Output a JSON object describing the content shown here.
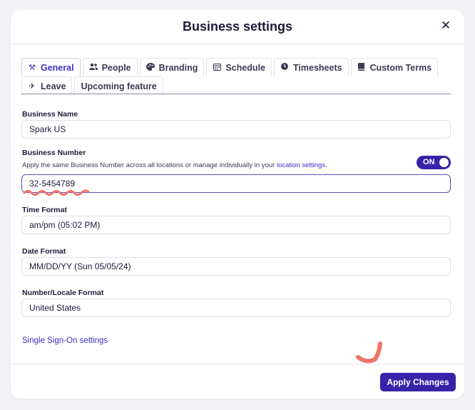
{
  "modal": {
    "title": "Business settings",
    "close_symbol": "✕"
  },
  "tabs": [
    {
      "label": "General",
      "icon": "tools-icon",
      "glyph": "⚒",
      "active": true
    },
    {
      "label": "People",
      "icon": "people-icon",
      "glyph": "👥"
    },
    {
      "label": "Branding",
      "icon": "palette-icon",
      "glyph": "◕"
    },
    {
      "label": "Schedule",
      "icon": "calendar-icon",
      "glyph": "▦"
    },
    {
      "label": "Timesheets",
      "icon": "clock-icon",
      "glyph": "◷"
    },
    {
      "label": "Custom Terms",
      "icon": "book-icon",
      "glyph": "▮"
    },
    {
      "label": "Leave",
      "icon": "plane-icon",
      "glyph": "✈"
    },
    {
      "label": "Upcoming feature",
      "icon": "",
      "glyph": ""
    }
  ],
  "form": {
    "business_name": {
      "label": "Business Name",
      "value": "Spark US"
    },
    "business_number": {
      "label": "Business Number",
      "help_text": "Apply the same Business Number across all locations or manage individually in your ",
      "help_link": "location settings",
      "help_suffix": ".",
      "toggle_label": "ON",
      "value": "32-5454789"
    },
    "time_format": {
      "label": "Time Format",
      "value": "am/pm (05:02 PM)"
    },
    "date_format": {
      "label": "Date Format",
      "value": "MM/DD/YY (Sun 05/05/24)"
    },
    "locale_format": {
      "label": "Number/Locale Format",
      "value": "United States"
    }
  },
  "links": {
    "sso": "Single Sign-On settings"
  },
  "footer": {
    "apply_label": "Apply Changes"
  },
  "colors": {
    "accent": "#3623a8",
    "link": "#3f2fc2",
    "annotation": "#f07468"
  }
}
